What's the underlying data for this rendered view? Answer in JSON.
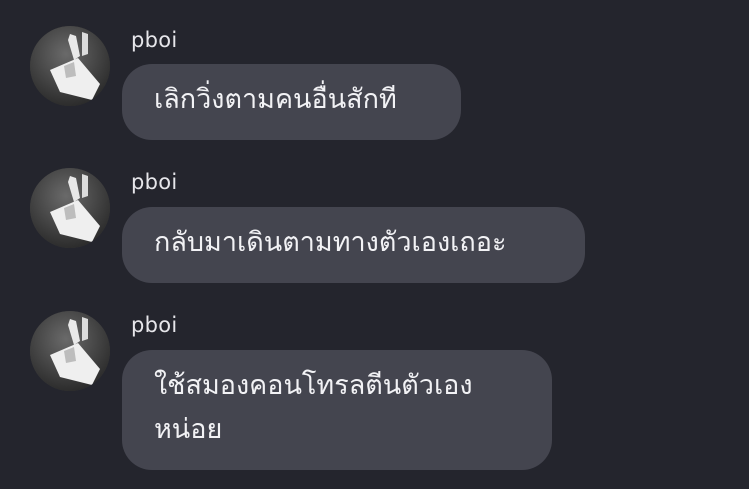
{
  "messages": [
    {
      "sender": "pboi",
      "text": "เลิกวิ่งตามคนอื่นสักที",
      "avatar_icon": "profile-photo-hand-raised"
    },
    {
      "sender": "pboi",
      "text": "กลับมาเดินตามทางตัวเองเถอะ",
      "avatar_icon": "profile-photo-hand-raised"
    },
    {
      "sender": "pboi",
      "text": "ใช้สมองคอนโทรลตีนตัวเอง\nหน่อย",
      "avatar_icon": "profile-photo-hand-raised"
    }
  ],
  "colors": {
    "background": "#24252d",
    "bubble": "#44454f",
    "text": "#f2f2f5",
    "sender": "#e6e6ea"
  }
}
